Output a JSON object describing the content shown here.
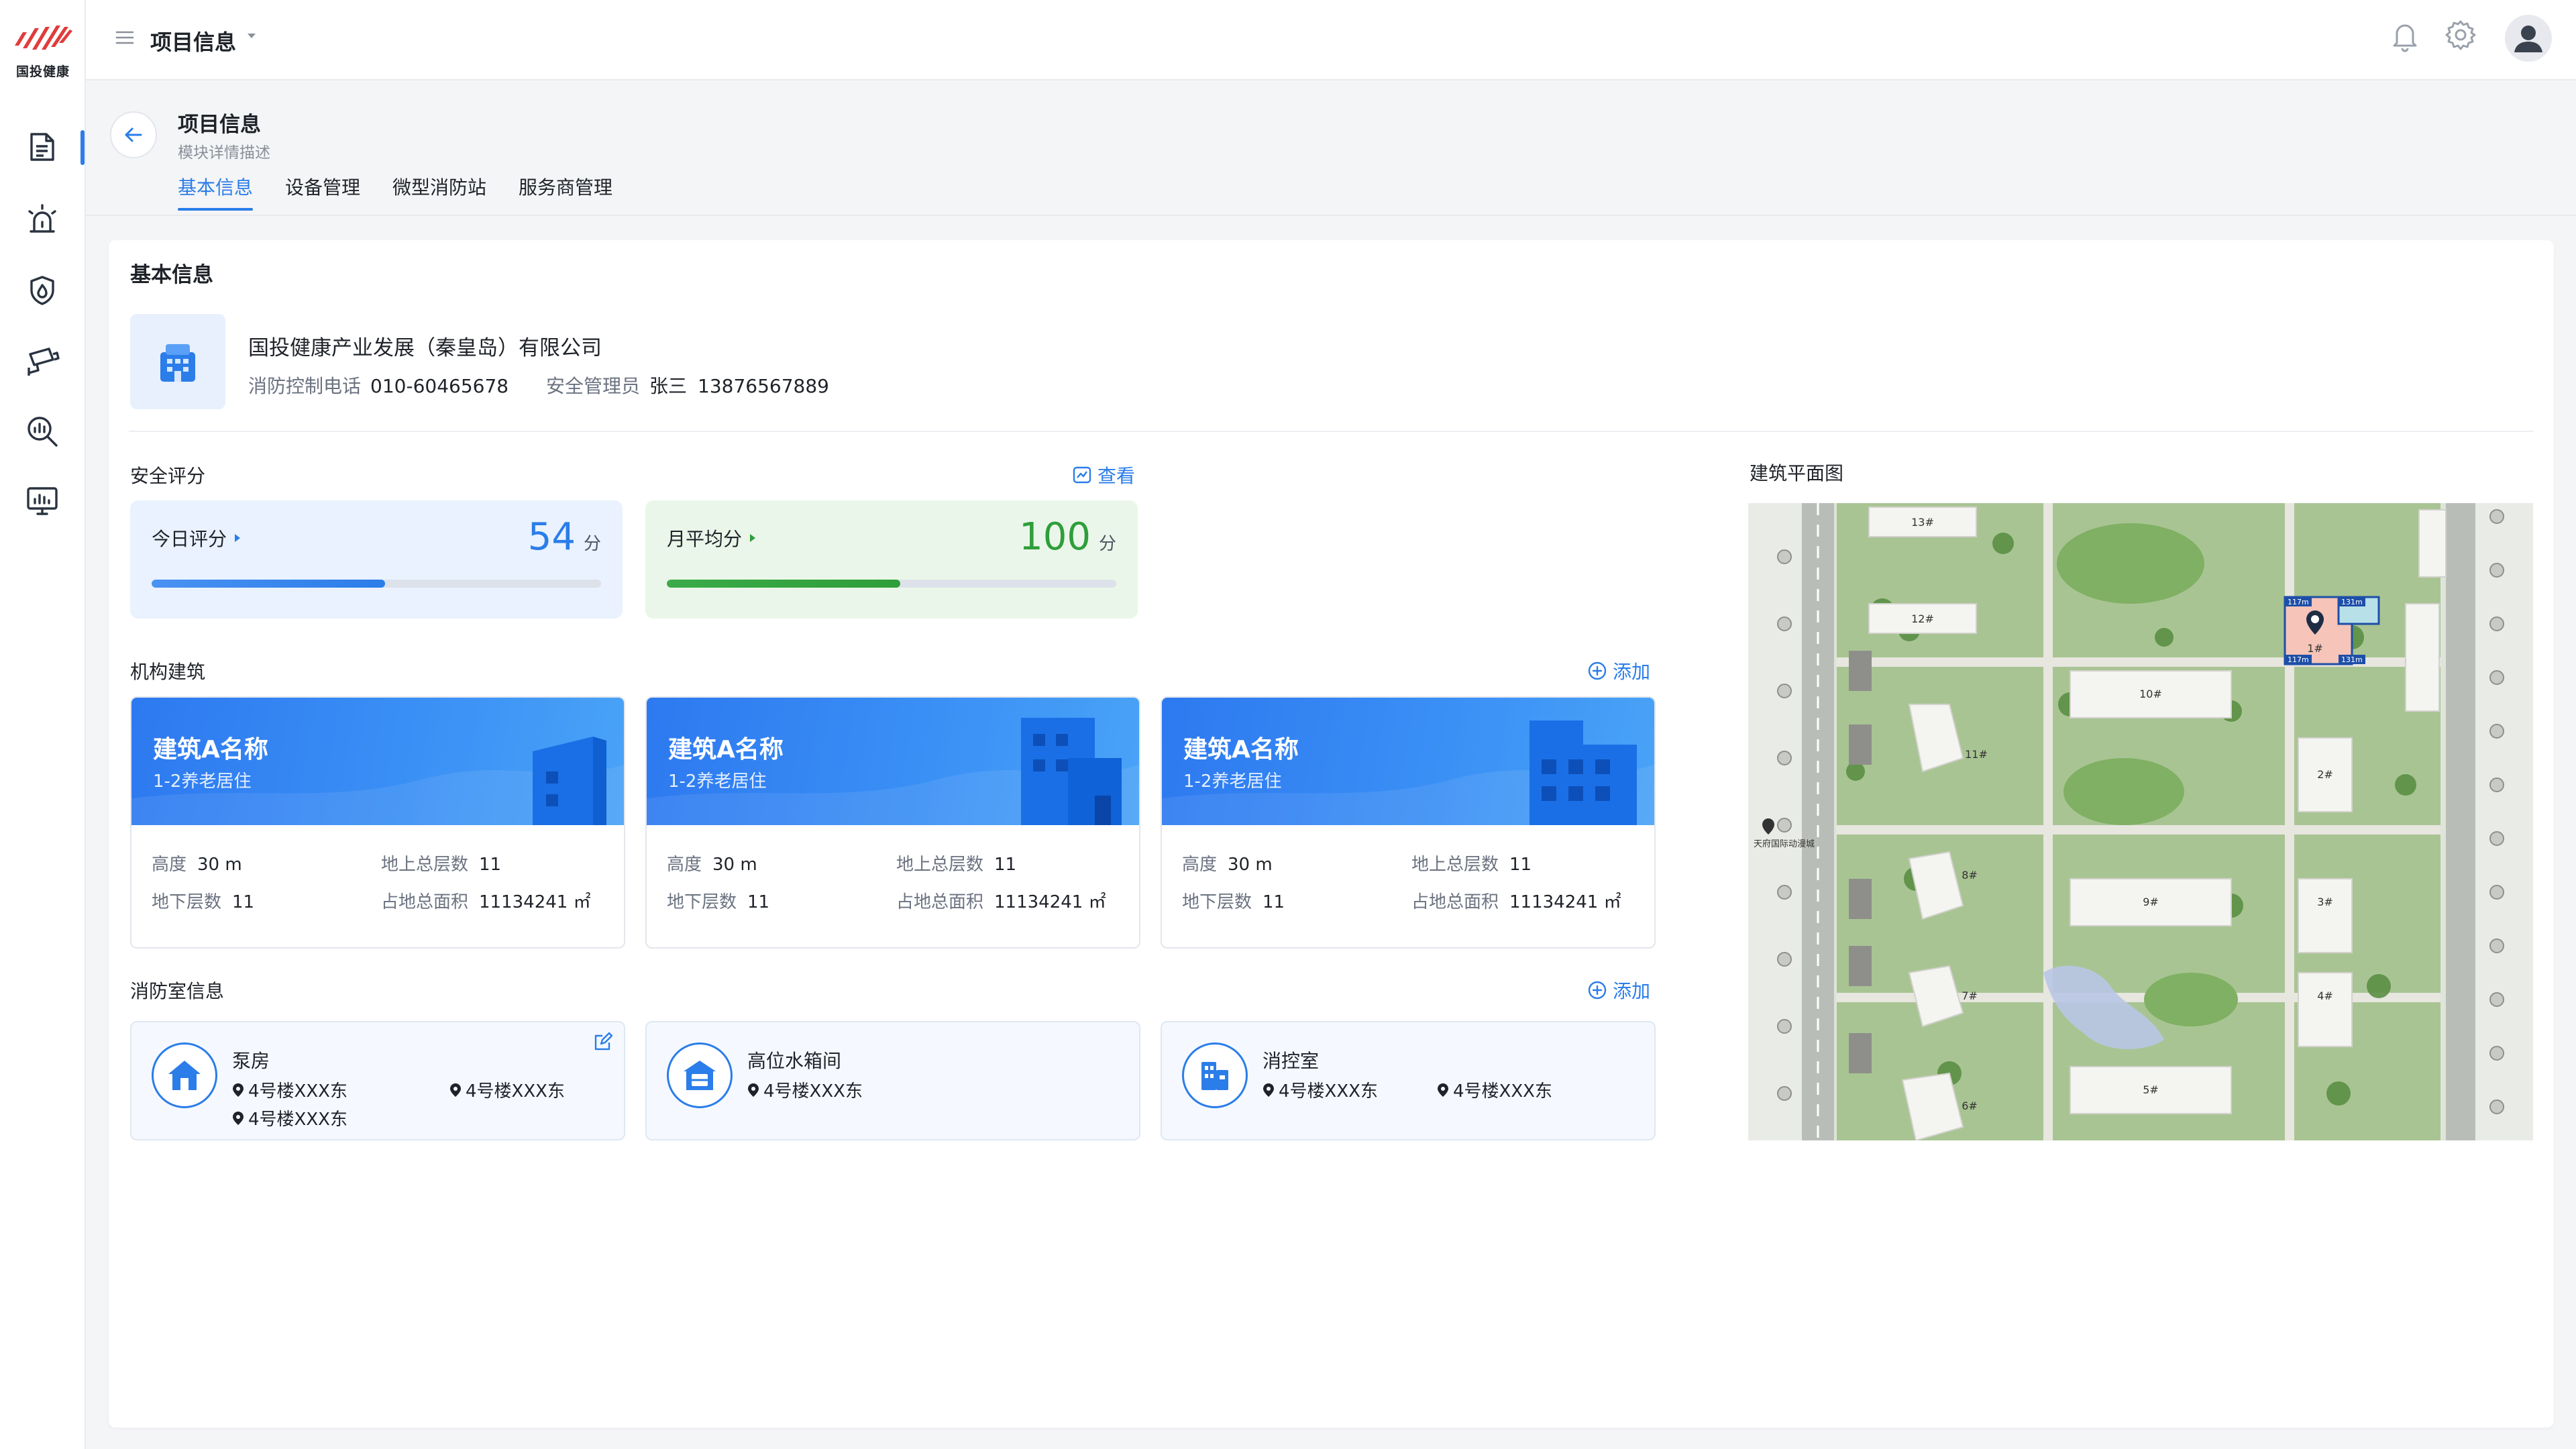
{
  "brand": {
    "logo_text": "国投健康",
    "accent": "#2b7de9",
    "logo_color": "#e03c3c"
  },
  "sidebar": {
    "items": [
      {
        "icon": "document-icon",
        "active": true
      },
      {
        "icon": "alarm-icon",
        "active": false
      },
      {
        "icon": "fire-shield-icon",
        "active": false
      },
      {
        "icon": "camera-icon",
        "active": false
      },
      {
        "icon": "search-chart-icon",
        "active": false
      },
      {
        "icon": "monitor-chart-icon",
        "active": false
      }
    ]
  },
  "topbar": {
    "title": "项目信息",
    "icons": [
      "menu-icon",
      "chevron-down-icon",
      "bell-icon",
      "gear-icon",
      "avatar"
    ]
  },
  "page": {
    "title": "项目信息",
    "description": "模块详情描述",
    "tabs": [
      {
        "label": "基本信息",
        "active": true
      },
      {
        "label": "设备管理",
        "active": false
      },
      {
        "label": "微型消防站",
        "active": false
      },
      {
        "label": "服务商管理",
        "active": false
      }
    ]
  },
  "basic": {
    "section_title": "基本信息",
    "org": {
      "name": "国投健康产业发展（秦皇岛）有限公司",
      "phone_label": "消防控制电话",
      "phone": "010-60465678",
      "manager_label": "安全管理员",
      "manager_name": "张三",
      "manager_phone": "13876567889"
    }
  },
  "safety": {
    "title": "安全评分",
    "view_label": "查看",
    "cards": [
      {
        "label": "今日评分",
        "value": "54",
        "unit": "分",
        "progress": 0.52,
        "color": "#2b7de9"
      },
      {
        "label": "月平均分",
        "value": "100",
        "unit": "分",
        "progress": 0.52,
        "color": "#2e9e3a"
      }
    ]
  },
  "buildings": {
    "title": "机构建筑",
    "add_label": "添加",
    "items": [
      {
        "name": "建筑A名称",
        "type": "1-2养老居住",
        "height_label": "高度",
        "height": "30 m",
        "floors_above_label": "地上总层数",
        "floors_above": "11",
        "floors_below_label": "地下层数",
        "floors_below": "11",
        "area_label": "占地总面积",
        "area": "11134241 ㎡"
      },
      {
        "name": "建筑A名称",
        "type": "1-2养老居住",
        "height_label": "高度",
        "height": "30 m",
        "floors_above_label": "地上总层数",
        "floors_above": "11",
        "floors_below_label": "地下层数",
        "floors_below": "11",
        "area_label": "占地总面积",
        "area": "11134241 ㎡"
      },
      {
        "name": "建筑A名称",
        "type": "1-2养老居住",
        "height_label": "高度",
        "height": "30 m",
        "floors_above_label": "地上总层数",
        "floors_above": "11",
        "floors_below_label": "地下层数",
        "floors_below": "11",
        "area_label": "占地总面积",
        "area": "11134241 ㎡"
      }
    ]
  },
  "fire_rooms": {
    "title": "消防室信息",
    "add_label": "添加",
    "items": [
      {
        "name": "泵房",
        "icon": "house-icon",
        "locations": [
          "4号楼XXX东",
          "4号楼XXX东",
          "4号楼XXX东"
        ]
      },
      {
        "name": "高位水箱间",
        "icon": "water-tank-icon",
        "locations": [
          "4号楼XXX东"
        ]
      },
      {
        "name": "消控室",
        "icon": "control-room-icon",
        "locations": [
          "4号楼XXX东",
          "4号楼XXX东"
        ]
      }
    ]
  },
  "floor_plan": {
    "title": "建筑平面图",
    "building_labels": [
      "13#",
      "12#",
      "10#",
      "11#",
      "1#",
      "2#",
      "9#",
      "8#",
      "3#",
      "7#",
      "4#",
      "5#",
      "6#"
    ],
    "marker_labels": [
      "117m",
      "131m",
      "117m",
      "131m"
    ],
    "place_label": "天府国际动漫城"
  }
}
